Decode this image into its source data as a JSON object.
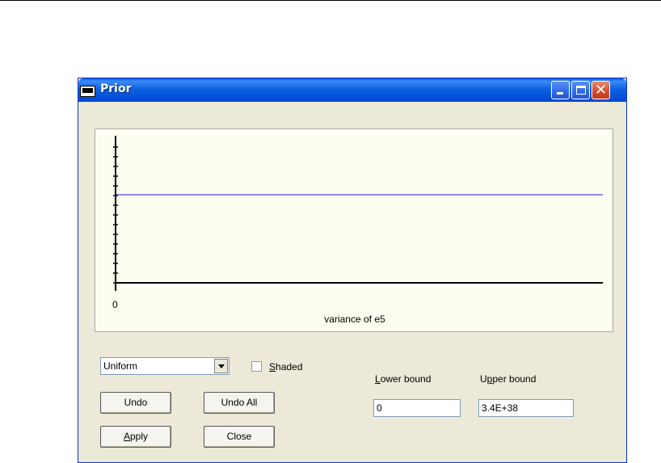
{
  "window": {
    "title": "Prior"
  },
  "chart_data": {
    "type": "line",
    "series": [
      {
        "values": [
          {
            "x": 0,
            "y": 1
          }
        ]
      }
    ],
    "xlabel": "variance of e5",
    "xticks": [
      "0"
    ],
    "yticks_count": 15,
    "line_color": "#1c1cdf"
  },
  "controls": {
    "distribution_select": {
      "value": "Uniform"
    },
    "shaded": {
      "label_accel": "S",
      "label_rest": "haded",
      "checked": false
    },
    "lower_bound": {
      "label_accel": "L",
      "label_rest": "ower bound",
      "value": "0"
    },
    "upper_bound": {
      "label_pre": "U",
      "label_accel": "p",
      "label_rest": "per bound",
      "value": "3.4E+38"
    },
    "undo_button": "Undo",
    "undo_all_button": "Undo All",
    "apply_button": {
      "label_accel": "A",
      "label_rest": "pply"
    },
    "close_button": "Close"
  },
  "colors": {
    "titlebar": "#0b5de0",
    "plot_bg": "#fefef0",
    "window_bg": "#ece9d8"
  }
}
